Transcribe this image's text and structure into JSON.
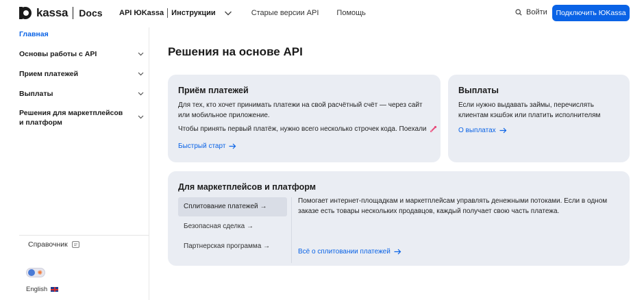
{
  "header": {
    "logo_text": "kassa",
    "logo_docs": "Docs",
    "nav_primary": "API ЮKassa",
    "nav_instructions": "Инструкции",
    "nav_old": "Старые версии API",
    "nav_help": "Помощь",
    "login": "Войти",
    "connect": "Подключить ЮKassa"
  },
  "sidebar": {
    "home": "Главная",
    "items": [
      {
        "label": "Основы работы с API"
      },
      {
        "label": "Прием платежей"
      },
      {
        "label": "Выплаты"
      },
      {
        "label_line1": "Решения для маркетплейсов",
        "label_line2": "и платформ"
      }
    ],
    "reference": "Справочник",
    "language": "English"
  },
  "main": {
    "title": "Решения на основе API",
    "payments_card": {
      "title": "Приём платежей",
      "text1": "Для тех, кто хочет принимать платежи на свой расчётный счёт — через сайт или мобильное приложение.",
      "text2": "Чтобы принять первый платёж, нужно всего несколько строчек кода. Поехали",
      "link": "Быстрый старт"
    },
    "payouts_card": {
      "title": "Выплаты",
      "text": "Если нужно выдавать займы, перечислять клиентам кэшбэк или платить исполнителям",
      "link": "О выплатах"
    },
    "marketplace_card": {
      "title": "Для маркетплейсов и платформ",
      "tabs": [
        {
          "label": "Сплитование платежей",
          "active": true
        },
        {
          "label": "Безопасная сделка",
          "active": false
        },
        {
          "label": "Партнерская программа",
          "active": false
        }
      ],
      "description": "Помогает интернет-площадкам и маркетплейсам управлять денежными потоками. Если в одном заказе есть товары нескольких продавцов, каждый получает свою часть платежа.",
      "link": "Всё о сплитовании платежей"
    }
  },
  "colors": {
    "accent": "#0a63e6",
    "card_bg": "#eaedf3"
  }
}
